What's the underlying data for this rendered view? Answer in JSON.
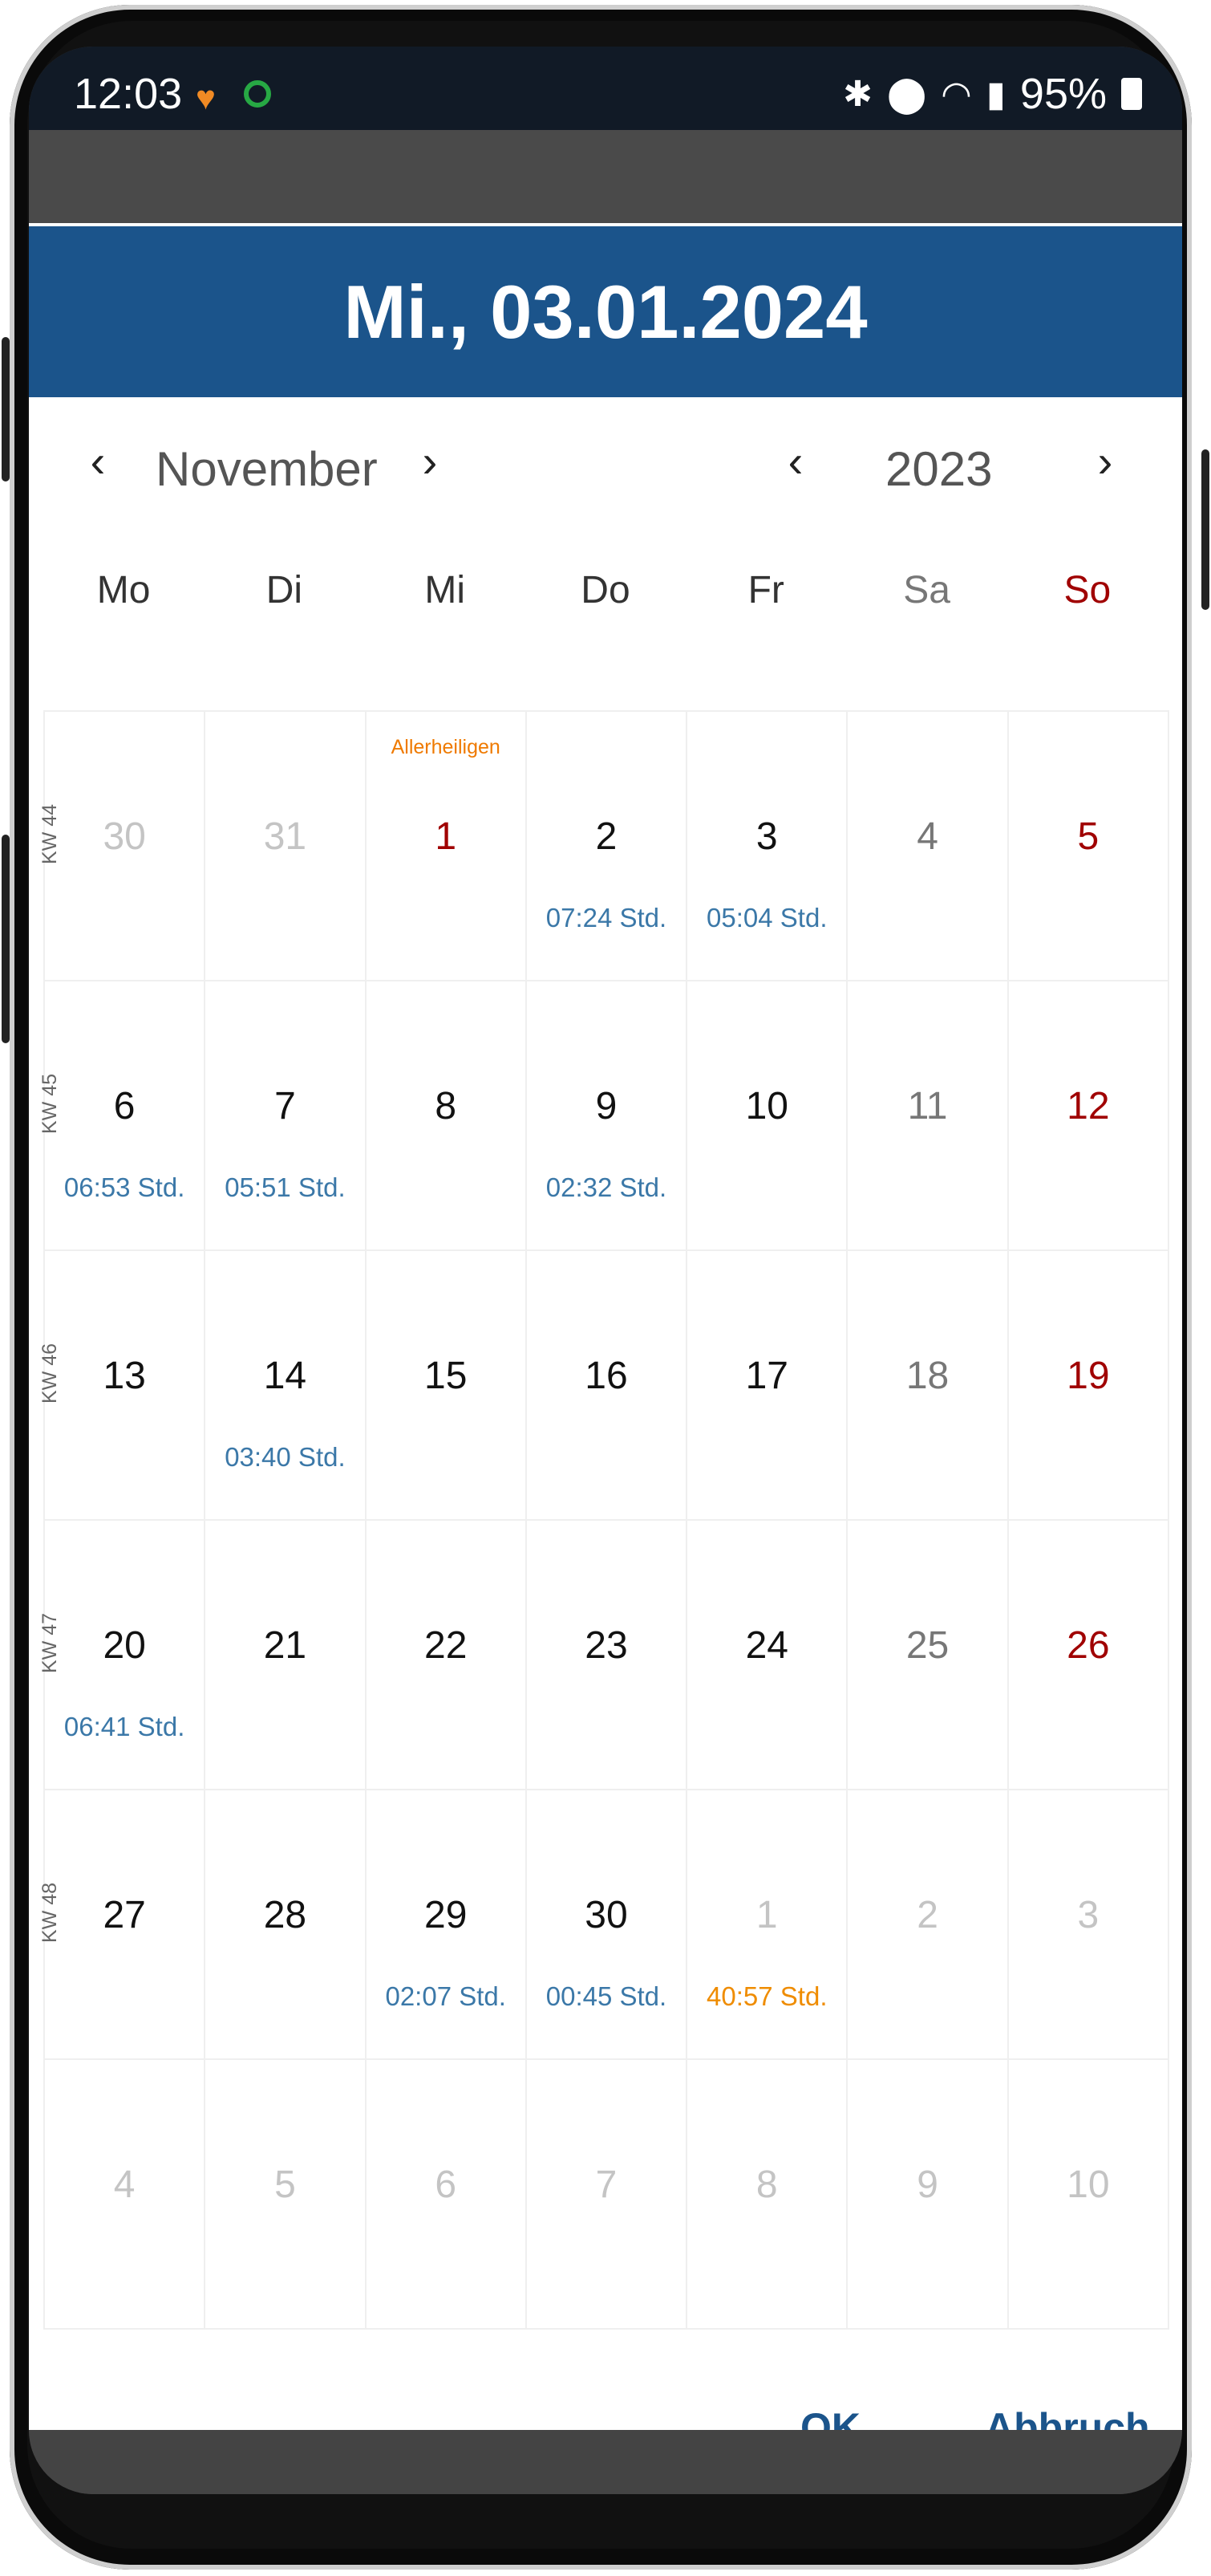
{
  "status_bar": {
    "time": "12:03",
    "battery": "95%",
    "icons": [
      "bluetooth-icon",
      "location-icon",
      "wifi-icon",
      "signal-icon",
      "battery-icon"
    ]
  },
  "dialog": {
    "header_date": "Mi., 03.01.2024",
    "month": "November",
    "year": "2023",
    "weekdays": [
      "Mo",
      "Di",
      "Mi",
      "Do",
      "Fr",
      "Sa",
      "So"
    ],
    "weeks": [
      {
        "kw": "KW 44",
        "days": [
          {
            "n": "30",
            "h": "",
            "hol": "",
            "t": "out"
          },
          {
            "n": "31",
            "h": "",
            "hol": "",
            "t": "out"
          },
          {
            "n": "1",
            "h": "",
            "hol": "Allerheiligen",
            "t": "holiday"
          },
          {
            "n": "2",
            "h": "07:24 Std.",
            "hol": "",
            "t": "day"
          },
          {
            "n": "3",
            "h": "05:04 Std.",
            "hol": "",
            "t": "day"
          },
          {
            "n": "4",
            "h": "",
            "hol": "",
            "t": "sat"
          },
          {
            "n": "5",
            "h": "",
            "hol": "",
            "t": "sun"
          }
        ]
      },
      {
        "kw": "KW 45",
        "days": [
          {
            "n": "6",
            "h": "06:53 Std.",
            "hol": "",
            "t": "day"
          },
          {
            "n": "7",
            "h": "05:51 Std.",
            "hol": "",
            "t": "day"
          },
          {
            "n": "8",
            "h": "",
            "hol": "",
            "t": "day"
          },
          {
            "n": "9",
            "h": "02:32 Std.",
            "hol": "",
            "t": "day"
          },
          {
            "n": "10",
            "h": "",
            "hol": "",
            "t": "day"
          },
          {
            "n": "11",
            "h": "",
            "hol": "",
            "t": "sat"
          },
          {
            "n": "12",
            "h": "",
            "hol": "",
            "t": "sun"
          }
        ]
      },
      {
        "kw": "KW 46",
        "days": [
          {
            "n": "13",
            "h": "",
            "hol": "",
            "t": "day"
          },
          {
            "n": "14",
            "h": "03:40 Std.",
            "hol": "",
            "t": "day"
          },
          {
            "n": "15",
            "h": "",
            "hol": "",
            "t": "day"
          },
          {
            "n": "16",
            "h": "",
            "hol": "",
            "t": "day"
          },
          {
            "n": "17",
            "h": "",
            "hol": "",
            "t": "day"
          },
          {
            "n": "18",
            "h": "",
            "hol": "",
            "t": "sat"
          },
          {
            "n": "19",
            "h": "",
            "hol": "",
            "t": "sun"
          }
        ]
      },
      {
        "kw": "KW 47",
        "days": [
          {
            "n": "20",
            "h": "06:41 Std.",
            "hol": "",
            "t": "day"
          },
          {
            "n": "21",
            "h": "",
            "hol": "",
            "t": "day"
          },
          {
            "n": "22",
            "h": "",
            "hol": "",
            "t": "day"
          },
          {
            "n": "23",
            "h": "",
            "hol": "",
            "t": "day"
          },
          {
            "n": "24",
            "h": "",
            "hol": "",
            "t": "day"
          },
          {
            "n": "25",
            "h": "",
            "hol": "",
            "t": "sat"
          },
          {
            "n": "26",
            "h": "",
            "hol": "",
            "t": "sun"
          }
        ]
      },
      {
        "kw": "KW 48",
        "days": [
          {
            "n": "27",
            "h": "",
            "hol": "",
            "t": "day"
          },
          {
            "n": "28",
            "h": "",
            "hol": "",
            "t": "day"
          },
          {
            "n": "29",
            "h": "02:07 Std.",
            "hol": "",
            "t": "day"
          },
          {
            "n": "30",
            "h": "00:45 Std.",
            "hol": "",
            "t": "day"
          },
          {
            "n": "1",
            "h": "40:57 Std.",
            "hol": "",
            "t": "out",
            "h_style": "total"
          },
          {
            "n": "2",
            "h": "",
            "hol": "",
            "t": "out"
          },
          {
            "n": "3",
            "h": "",
            "hol": "",
            "t": "out"
          }
        ]
      },
      {
        "kw": "",
        "days": [
          {
            "n": "4",
            "h": "",
            "hol": "",
            "t": "out"
          },
          {
            "n": "5",
            "h": "",
            "hol": "",
            "t": "out"
          },
          {
            "n": "6",
            "h": "",
            "hol": "",
            "t": "out"
          },
          {
            "n": "7",
            "h": "",
            "hol": "",
            "t": "out"
          },
          {
            "n": "8",
            "h": "",
            "hol": "",
            "t": "out"
          },
          {
            "n": "9",
            "h": "",
            "hol": "",
            "t": "out"
          },
          {
            "n": "10",
            "h": "",
            "hol": "",
            "t": "out"
          }
        ]
      }
    ],
    "ok_label": "OK",
    "cancel_label": "Abbruch"
  },
  "colors": {
    "header_bg": "#1b548b",
    "sunday": "#a00000",
    "saturday": "#777777",
    "out_of_month": "#c4c4c4",
    "hours": "#3b78a8",
    "total_hours": "#ef8c00",
    "holiday": "#ef7a00"
  }
}
